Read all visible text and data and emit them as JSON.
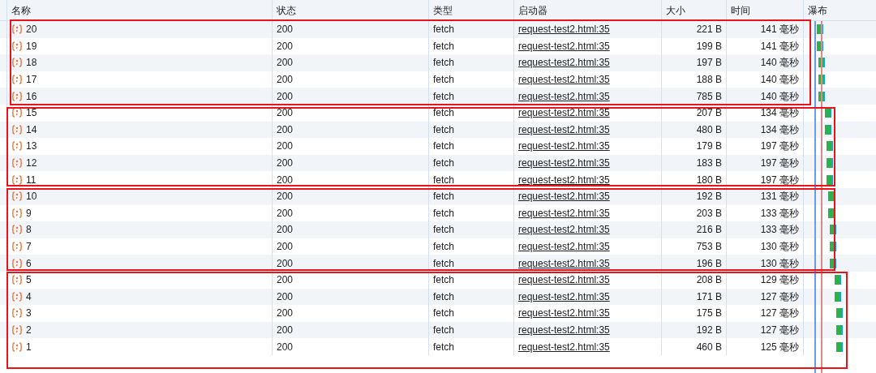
{
  "columns": [
    "名称",
    "状态",
    "类型",
    "启动器",
    "大小",
    "时间",
    "瀑布"
  ],
  "groups": [
    {
      "rows": [
        {
          "name": "20",
          "status": "200",
          "type": "fetch",
          "initiator": "request-test2.html:35",
          "size": "221 B",
          "time": "141 毫秒"
        },
        {
          "name": "19",
          "status": "200",
          "type": "fetch",
          "initiator": "request-test2.html:35",
          "size": "199 B",
          "time": "141 毫秒"
        },
        {
          "name": "18",
          "status": "200",
          "type": "fetch",
          "initiator": "request-test2.html:35",
          "size": "197 B",
          "time": "140 毫秒"
        },
        {
          "name": "17",
          "status": "200",
          "type": "fetch",
          "initiator": "request-test2.html:35",
          "size": "188 B",
          "time": "140 毫秒"
        },
        {
          "name": "16",
          "status": "200",
          "type": "fetch",
          "initiator": "request-test2.html:35",
          "size": "785 B",
          "time": "140 毫秒"
        }
      ]
    },
    {
      "rows": [
        {
          "name": "15",
          "status": "200",
          "type": "fetch",
          "initiator": "request-test2.html:35",
          "size": "207 B",
          "time": "134 毫秒"
        },
        {
          "name": "14",
          "status": "200",
          "type": "fetch",
          "initiator": "request-test2.html:35",
          "size": "480 B",
          "time": "134 毫秒"
        },
        {
          "name": "13",
          "status": "200",
          "type": "fetch",
          "initiator": "request-test2.html:35",
          "size": "179 B",
          "time": "197 毫秒"
        },
        {
          "name": "12",
          "status": "200",
          "type": "fetch",
          "initiator": "request-test2.html:35",
          "size": "183 B",
          "time": "197 毫秒"
        },
        {
          "name": "11",
          "status": "200",
          "type": "fetch",
          "initiator": "request-test2.html:35",
          "size": "180 B",
          "time": "197 毫秒"
        }
      ]
    },
    {
      "rows": [
        {
          "name": "10",
          "status": "200",
          "type": "fetch",
          "initiator": "request-test2.html:35",
          "size": "192 B",
          "time": "131 毫秒"
        },
        {
          "name": "9",
          "status": "200",
          "type": "fetch",
          "initiator": "request-test2.html:35",
          "size": "203 B",
          "time": "133 毫秒"
        },
        {
          "name": "8",
          "status": "200",
          "type": "fetch",
          "initiator": "request-test2.html:35",
          "size": "216 B",
          "time": "133 毫秒"
        },
        {
          "name": "7",
          "status": "200",
          "type": "fetch",
          "initiator": "request-test2.html:35",
          "size": "753 B",
          "time": "130 毫秒"
        },
        {
          "name": "6",
          "status": "200",
          "type": "fetch",
          "initiator": "request-test2.html:35",
          "size": "196 B",
          "time": "130 毫秒"
        }
      ]
    },
    {
      "rows": [
        {
          "name": "5",
          "status": "200",
          "type": "fetch",
          "initiator": "request-test2.html:35",
          "size": "208 B",
          "time": "129 毫秒"
        },
        {
          "name": "4",
          "status": "200",
          "type": "fetch",
          "initiator": "request-test2.html:35",
          "size": "171 B",
          "time": "127 毫秒"
        },
        {
          "name": "3",
          "status": "200",
          "type": "fetch",
          "initiator": "request-test2.html:35",
          "size": "175 B",
          "time": "127 毫秒"
        },
        {
          "name": "2",
          "status": "200",
          "type": "fetch",
          "initiator": "request-test2.html:35",
          "size": "192 B",
          "time": "127 毫秒"
        },
        {
          "name": "1",
          "status": "200",
          "type": "fetch",
          "initiator": "request-test2.html:35",
          "size": "460 B",
          "time": "125 毫秒"
        }
      ]
    }
  ]
}
